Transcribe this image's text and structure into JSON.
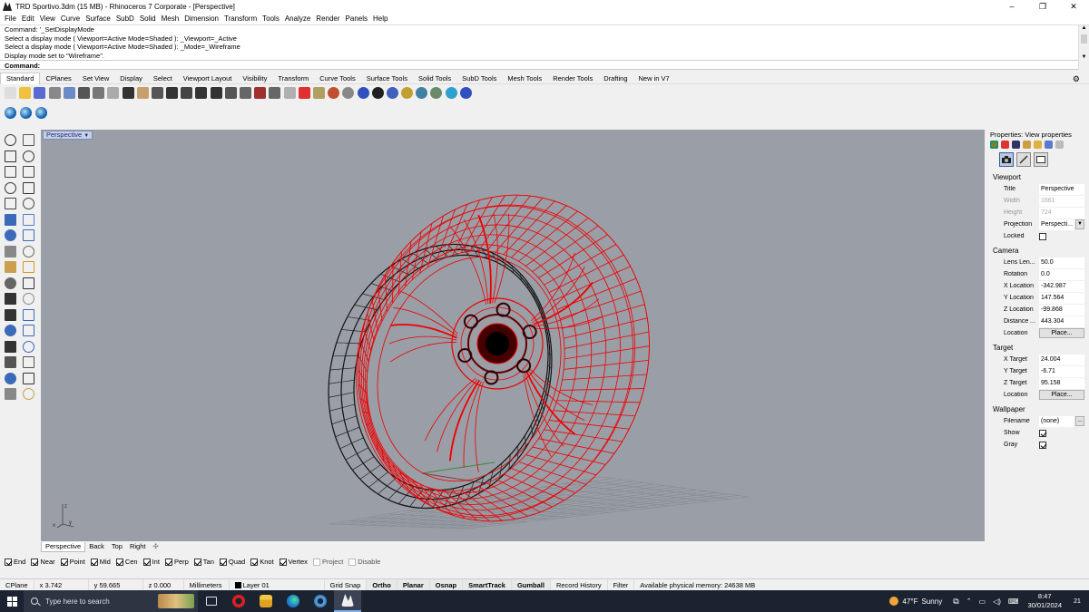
{
  "window": {
    "title": "TRD Sportivo.3dm (15 MB) - Rhinoceros 7 Corporate - [Perspective]",
    "controls": [
      "–",
      "❐",
      "✕"
    ]
  },
  "menu": [
    "File",
    "Edit",
    "View",
    "Curve",
    "Surface",
    "SubD",
    "Solid",
    "Mesh",
    "Dimension",
    "Transform",
    "Tools",
    "Analyze",
    "Render",
    "Panels",
    "Help"
  ],
  "command_history": [
    "Command: '_SetDisplayMode",
    "Select a display mode ( Viewport=Active  Mode=Shaded ): _Viewport=_Active",
    "Select a display mode ( Viewport=Active  Mode=Shaded ): _Mode=_Wireframe",
    "Display mode set to \"Wireframe\"."
  ],
  "command_prompt": "Command:",
  "toolbar_tabs": [
    "Standard",
    "CPlanes",
    "Set View",
    "Display",
    "Select",
    "Viewport Layout",
    "Visibility",
    "Transform",
    "Curve Tools",
    "Surface Tools",
    "Solid Tools",
    "SubD Tools",
    "Mesh Tools",
    "Render Tools",
    "Drafting",
    "New in V7"
  ],
  "active_tab": "Standard",
  "toolbar_icons": [
    "new-icon",
    "open-icon",
    "save-icon",
    "print-icon",
    "import-icon",
    "cut-icon",
    "copy-icon",
    "paste-icon",
    "undo-icon",
    "pan-icon",
    "move-view-icon",
    "zoom-dynamic-icon",
    "zoom-window-icon",
    "zoom-extents-icon",
    "zoom-selected-icon",
    "rotate-view-icon",
    "four-view-icon",
    "cplane-icon",
    "grid-icon",
    "object-properties-icon",
    "hide-icon",
    "lock-icon",
    "layer-icon",
    "render-preview-icon",
    "material-icon",
    "shaded-icon",
    "sphere-icon",
    "light-icon",
    "environment-icon",
    "options-icon",
    "dimension-icon",
    "help-icon"
  ],
  "viewport": {
    "label": "Perspective",
    "tabs": [
      "Perspective",
      "Back",
      "Top",
      "Right"
    ],
    "add_tab": "✣",
    "axis_x": "x",
    "axis_y": "y",
    "axis_z": "z"
  },
  "osnaps": [
    {
      "label": "End",
      "checked": true
    },
    {
      "label": "Near",
      "checked": true
    },
    {
      "label": "Point",
      "checked": true
    },
    {
      "label": "Mid",
      "checked": true
    },
    {
      "label": "Cen",
      "checked": true
    },
    {
      "label": "Int",
      "checked": true
    },
    {
      "label": "Perp",
      "checked": true
    },
    {
      "label": "Tan",
      "checked": true
    },
    {
      "label": "Quad",
      "checked": true
    },
    {
      "label": "Knot",
      "checked": true
    },
    {
      "label": "Vertex",
      "checked": true
    },
    {
      "label": "Project",
      "checked": false
    },
    {
      "label": "Disable",
      "checked": false
    }
  ],
  "status": {
    "cplane": "CPlane",
    "x": "x 3.742",
    "y": "y 59.665",
    "z": "z 0.000",
    "units": "Millimeters",
    "layer": "Layer 01",
    "grid_snap": "Grid Snap",
    "ortho": "Ortho",
    "planar": "Planar",
    "osnap": "Osnap",
    "smarttrack": "SmartTrack",
    "gumball": "Gumball",
    "record_history": "Record History",
    "filter": "Filter",
    "memory": "Available physical memory: 24638 MB"
  },
  "properties": {
    "header": "Properties: View properties",
    "viewport_section": "Viewport",
    "title_label": "Title",
    "title_value": "Perspective",
    "width_label": "Width",
    "width_value": "1661",
    "height_label": "Height",
    "height_value": "724",
    "projection_label": "Projection",
    "projection_value": "Perspecti...",
    "locked_label": "Locked",
    "camera_section": "Camera",
    "lens_label": "Lens Len...",
    "lens_value": "50.0",
    "rotation_label": "Rotation",
    "rotation_value": "0.0",
    "xloc_label": "X Location",
    "xloc_value": "-342.987",
    "yloc_label": "Y Location",
    "yloc_value": "147.564",
    "zloc_label": "Z Location",
    "zloc_value": "-99.868",
    "distance_label": "Distance ...",
    "distance_value": "443.304",
    "location_label": "Location",
    "place_button": "Place...",
    "target_section": "Target",
    "xt_label": "X Target",
    "xt_value": "24.004",
    "yt_label": "Y Target",
    "yt_value": "-6.71",
    "zt_label": "Z Target",
    "zt_value": "95.158",
    "tlocation_label": "Location",
    "tplace_button": "Place...",
    "wallpaper_section": "Wallpaper",
    "filename_label": "Filename",
    "filename_value": "(none)",
    "browse_button": "...",
    "show_label": "Show",
    "gray_label": "Gray"
  },
  "taskbar": {
    "search_placeholder": "Type here to search",
    "weather_temp": "47°F",
    "weather_text": "Sunny",
    "time": "8:47",
    "date": "30/01/2024",
    "notifications": "21"
  }
}
